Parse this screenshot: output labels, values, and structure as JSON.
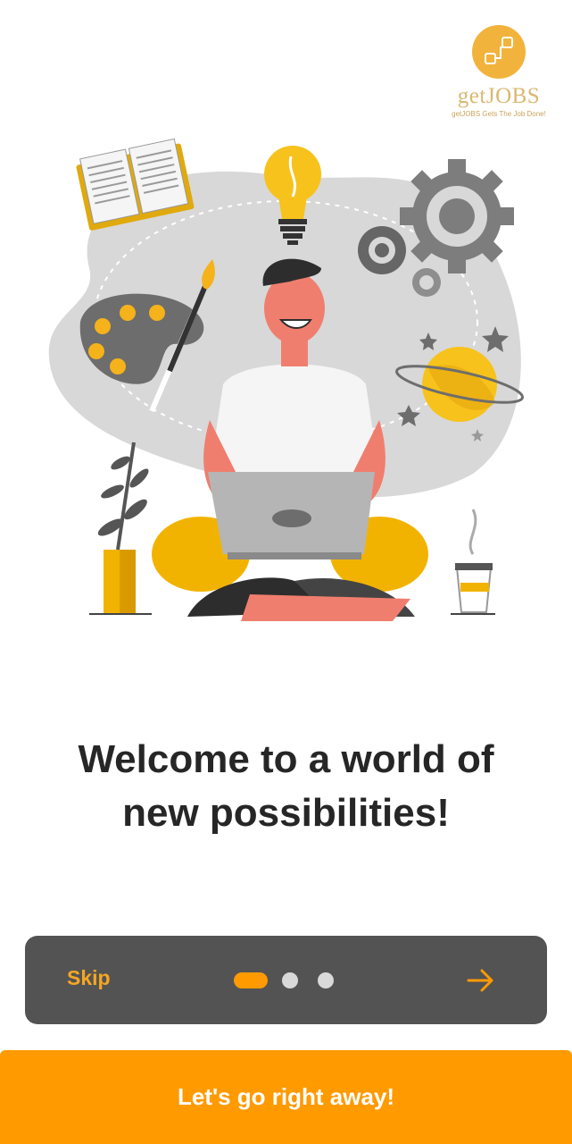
{
  "brand": {
    "name": "getJOBS",
    "tagline": "getJOBS Gets The Job Done!",
    "icon": "logo-squares-icon",
    "color": "#f2b33d"
  },
  "illustration": {
    "icon": "developer-meditating-illustration"
  },
  "onboarding": {
    "headline_line1": "Welcome to a world of",
    "headline_line2": "new possibilities!",
    "skip_label": "Skip",
    "page_count": 3,
    "current_page": 1,
    "next_icon": "arrow-right-icon",
    "cta_label": "Let's go right away!"
  },
  "colors": {
    "accent": "#ff9a00",
    "pager_background": "#535353",
    "headline": "#262626",
    "dot_inactive": "#d9d9d9"
  }
}
